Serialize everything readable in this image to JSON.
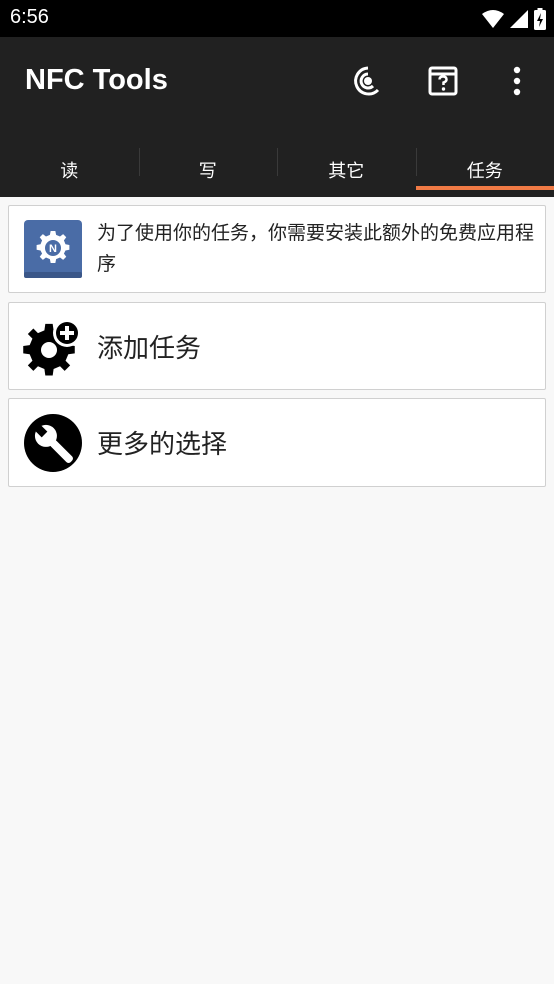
{
  "status_bar": {
    "time": "6:56"
  },
  "app_bar": {
    "title": "NFC Tools",
    "actions": [
      "nfc-scan-icon",
      "help-icon",
      "more-options-icon"
    ]
  },
  "tabs": [
    {
      "label": "读",
      "active": false
    },
    {
      "label": "写",
      "active": false
    },
    {
      "label": "其它",
      "active": false
    },
    {
      "label": "任务",
      "active": true
    }
  ],
  "cards": [
    {
      "text": "为了使用你的任务，你需要安装此额外的免费应用程序",
      "icon": "nfc-tasks-app-icon"
    },
    {
      "text": "添加任务",
      "icon": "add-task-gear-icon"
    },
    {
      "text": "更多的选择",
      "icon": "wrench-icon"
    }
  ],
  "colors": {
    "accent": "#f07a45",
    "app_bar": "#212121",
    "background": "#f8f8f8",
    "app_icon": "#4a6ca6"
  }
}
